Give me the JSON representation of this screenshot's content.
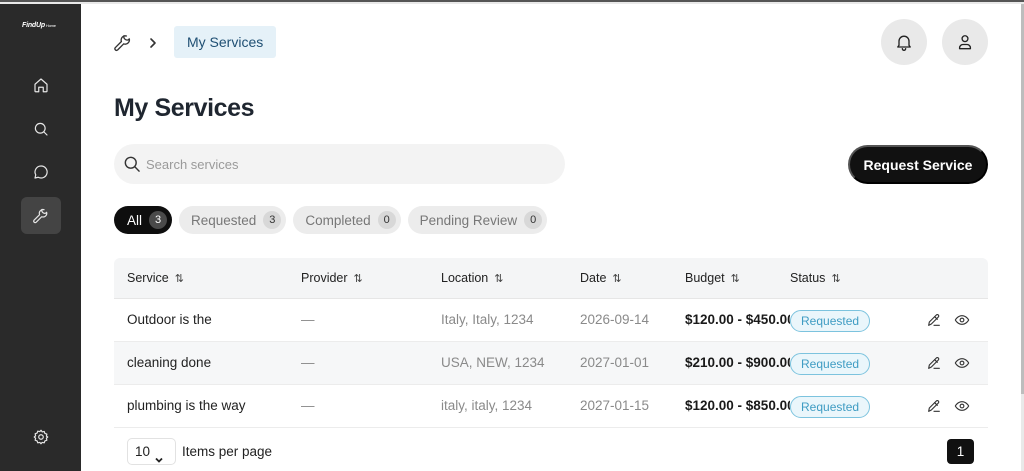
{
  "app": {
    "logo_text": "FindUp",
    "logo_sub": "Home"
  },
  "breadcrumb": {
    "current": "My Services"
  },
  "page": {
    "title": "My Services"
  },
  "search": {
    "placeholder": "Search services",
    "value": ""
  },
  "actions": {
    "request_label": "Request Service"
  },
  "tabs": [
    {
      "label": "All",
      "count": "3",
      "active": true
    },
    {
      "label": "Requested",
      "count": "3"
    },
    {
      "label": "Completed",
      "count": "0"
    },
    {
      "label": "Pending Review",
      "count": "0"
    }
  ],
  "table": {
    "columns": [
      "Service",
      "Provider",
      "Location",
      "Date",
      "Budget",
      "Status"
    ],
    "sort_glyph": "⇅",
    "rows": [
      {
        "service": "Outdoor is the",
        "provider": "—",
        "location": "Italy, Italy, 1234",
        "date": "2026-09-14",
        "budget": "$120.00 - $450.00",
        "status": "Requested"
      },
      {
        "service": "cleaning done",
        "provider": "—",
        "location": "USA, NEW, 1234",
        "date": "2027-01-01",
        "budget": "$210.00 - $900.00",
        "status": "Requested"
      },
      {
        "service": "plumbing is the way",
        "provider": "—",
        "location": "italy, italy, 1234",
        "date": "2027-01-15",
        "budget": "$120.00 - $850.00",
        "status": "Requested"
      }
    ]
  },
  "pagination": {
    "page_size": "10",
    "items_per_page_label": "Items per page",
    "current_page": "1"
  },
  "icons": {
    "sidebar": [
      "home-icon",
      "search-icon",
      "chat-icon",
      "wrench-icon",
      "gear-icon"
    ],
    "header": [
      "bell-icon",
      "user-icon"
    ],
    "row_actions": [
      "edit-icon",
      "view-icon"
    ]
  },
  "colors": {
    "sidebar": "#2a2a2a",
    "primary": "#111111",
    "status_requested": "#3f9cc3",
    "breadcrumb_bg": "#e5f1f8"
  }
}
